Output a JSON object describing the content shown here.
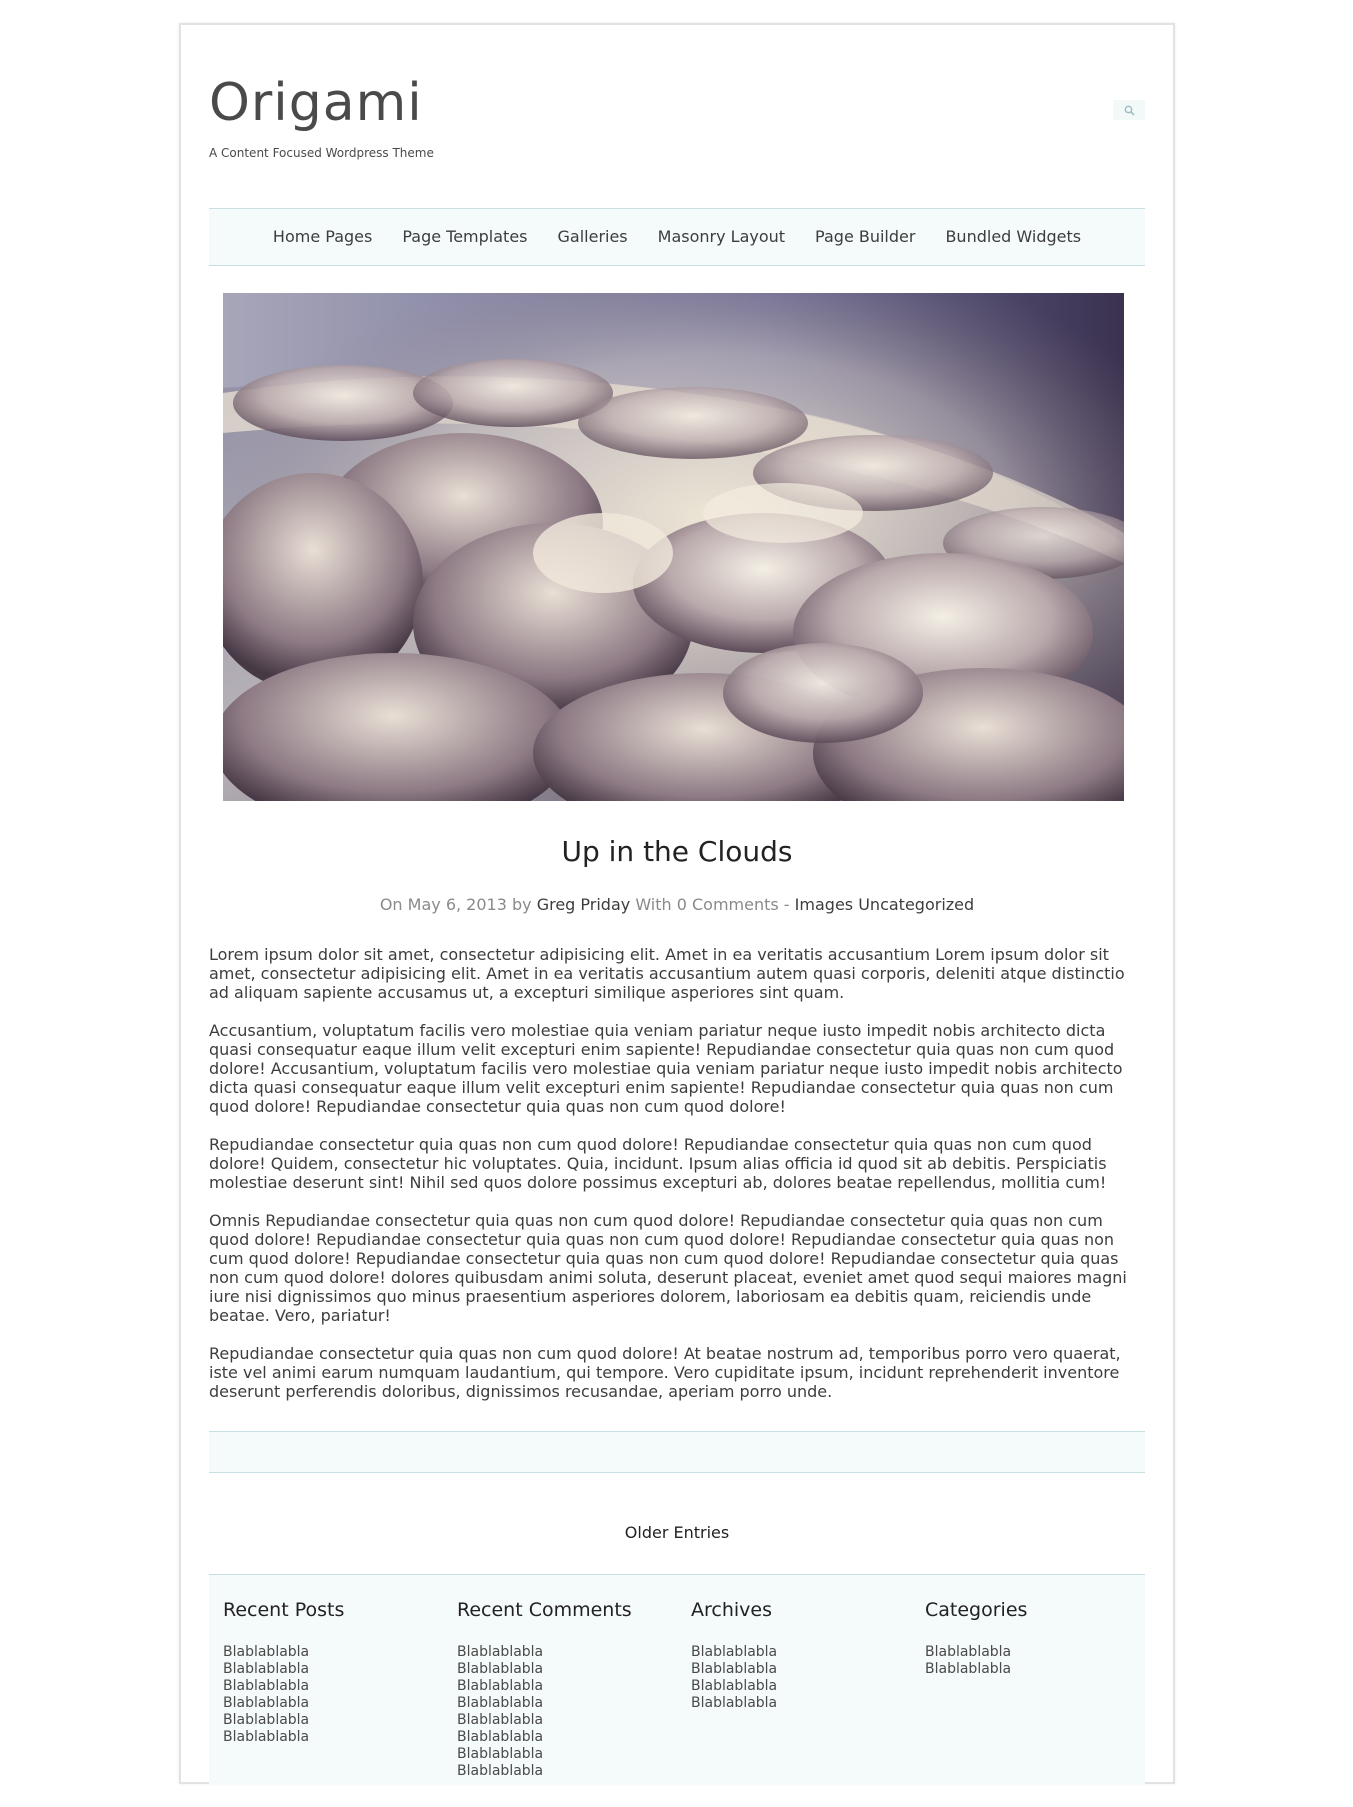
{
  "site": {
    "title": "Origami",
    "tagline": "A Content Focused Wordpress Theme"
  },
  "search": {
    "icon": "search-icon"
  },
  "nav": {
    "items": [
      {
        "label": "Home Pages"
      },
      {
        "label": "Page Templates"
      },
      {
        "label": "Galleries"
      },
      {
        "label": "Masonry Layout"
      },
      {
        "label": "Page Builder"
      },
      {
        "label": "Bundled Widgets"
      }
    ]
  },
  "post": {
    "title": "Up in the Clouds",
    "meta": {
      "prefix": "On May 6, 2013 by",
      "author": "Greg Priday",
      "comments": "With 0 Comments -",
      "category1": "Images",
      "category2": "Uncategorized"
    },
    "paragraphs": [
      "Lorem ipsum dolor sit amet, consectetur adipisicing elit. Amet in ea veritatis accusantium Lorem ipsum dolor sit amet, consectetur adipisicing elit. Amet in ea veritatis accusantium autem quasi corporis, deleniti atque distinctio ad aliquam sapiente accusamus ut, a excepturi similique asperiores sint quam.",
      "Accusantium, voluptatum facilis vero molestiae quia veniam pariatur neque iusto impedit nobis architecto dicta quasi consequatur eaque illum velit excepturi enim sapiente! Repudiandae consectetur quia quas non cum quod dolore! Accusantium, voluptatum facilis vero molestiae quia veniam pariatur neque iusto impedit nobis architecto dicta quasi consequatur eaque illum velit excepturi enim sapiente! Repudiandae consectetur quia quas non cum quod dolore! Repudiandae consectetur quia quas non cum quod dolore!",
      "Repudiandae consectetur quia quas non cum quod dolore! Repudiandae consectetur quia quas non cum quod dolore! Quidem, consectetur hic voluptates. Quia, incidunt. Ipsum alias officia id quod sit ab debitis. Perspiciatis molestiae deserunt sint! Nihil sed quos dolore possimus excepturi ab, dolores beatae repellendus, mollitia cum!",
      "Omnis Repudiandae consectetur quia quas non cum quod dolore! Repudiandae consectetur quia quas non cum quod dolore! Repudiandae consectetur quia quas non cum quod dolore! Repudiandae consectetur quia quas non cum quod dolore! Repudiandae consectetur quia quas non cum quod dolore! Repudiandae consectetur quia quas non cum quod dolore! dolores quibusdam animi soluta, deserunt placeat, eveniet amet quod sequi maiores magni iure nisi dignissimos quo minus praesentium asperiores dolorem, laboriosam ea debitis quam, reiciendis unde beatae. Vero, pariatur!",
      "Repudiandae consectetur quia quas non cum quod dolore! At beatae nostrum ad, temporibus porro vero quaerat, iste vel animi earum numquam laudantium, qui tempore. Vero cupiditate ipsum, incidunt reprehenderit inventore deserunt perferendis doloribus, dignissimos recusandae, aperiam porro unde."
    ]
  },
  "pagination": {
    "older_label": "Older Entries"
  },
  "footer": {
    "widgets": [
      {
        "title": "Recent Posts",
        "items": [
          "Blablablabla",
          "Blablablabla",
          "Blablablabla",
          "Blablablabla",
          "Blablablabla",
          "Blablablabla"
        ]
      },
      {
        "title": "Recent Comments",
        "items": [
          "Blablablabla",
          "Blablablabla",
          "Blablablabla",
          "Blablablabla",
          "Blablablabla",
          "Blablablabla",
          "Blablablabla",
          "Blablablabla"
        ]
      },
      {
        "title": "Archives",
        "items": [
          "Blablablabla",
          "Blablablabla",
          "Blablablabla",
          "Blablablabla"
        ]
      },
      {
        "title": "Categories",
        "items": [
          "Blablablabla",
          "Blablablabla"
        ]
      }
    ]
  },
  "colors": {
    "band_background": "#f5fafa",
    "band_border": "#c9e0e3",
    "text": "#3d3d3d"
  }
}
